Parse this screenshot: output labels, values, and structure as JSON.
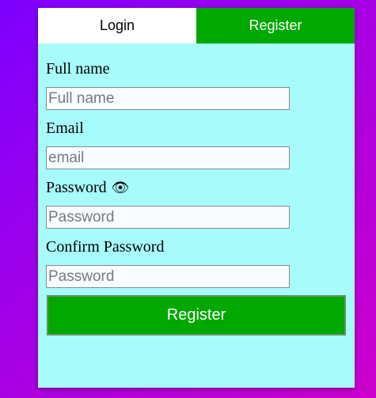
{
  "tabs": {
    "login": "Login",
    "register": "Register"
  },
  "form": {
    "full_name": {
      "label": "Full name",
      "placeholder": "Full name",
      "value": ""
    },
    "email": {
      "label": "Email",
      "placeholder": "email",
      "value": ""
    },
    "password": {
      "label": "Password",
      "placeholder": "Password",
      "value": "",
      "icon": "eye-icon"
    },
    "confirm_password": {
      "label": "Confirm Password",
      "placeholder": "Password",
      "value": ""
    },
    "submit_label": "Register"
  },
  "colors": {
    "card_background": "#a8fbfb",
    "accent_green": "#00a800",
    "background_gradient_start": "#7d00ff",
    "background_gradient_end": "#cc00cc"
  }
}
